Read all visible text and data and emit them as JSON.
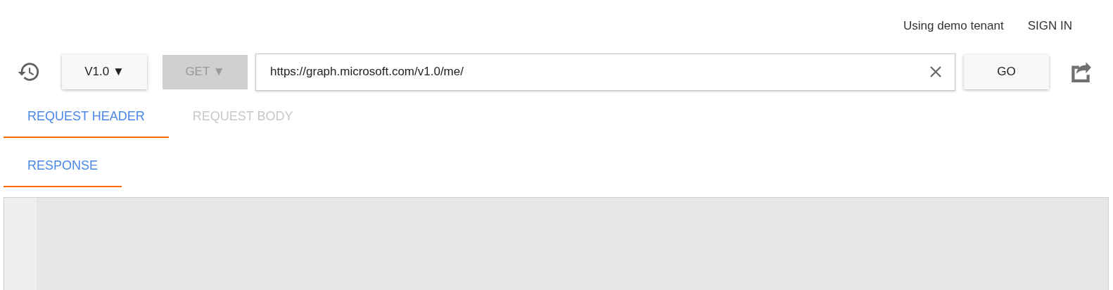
{
  "header": {
    "tenant": "Using demo tenant",
    "sign_in": "SIGN IN"
  },
  "toolbar": {
    "version": "V1.0 ▼",
    "method": {
      "label": "GET ▼",
      "disabled": true
    },
    "url": "https://graph.microsoft.com/v1.0/me/",
    "go": "GO"
  },
  "request_tabs": [
    {
      "label": "REQUEST HEADER",
      "selected": true,
      "disabled": false
    },
    {
      "label": "REQUEST BODY",
      "selected": false,
      "disabled": true
    }
  ],
  "response_tabs": [
    {
      "label": "RESPONSE",
      "selected": true,
      "disabled": false
    }
  ]
}
